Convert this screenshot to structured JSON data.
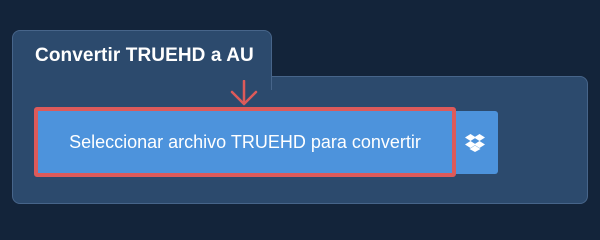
{
  "tab": {
    "title": "Convertir TRUEHD a AU"
  },
  "upload": {
    "select_label": "Seleccionar archivo TRUEHD para convertir",
    "dropbox_icon": "dropbox-icon"
  },
  "colors": {
    "page_bg": "#13243a",
    "card_bg": "#2c4a6d",
    "button_blue": "#4d93dc",
    "highlight_red": "#dd5a5a"
  }
}
